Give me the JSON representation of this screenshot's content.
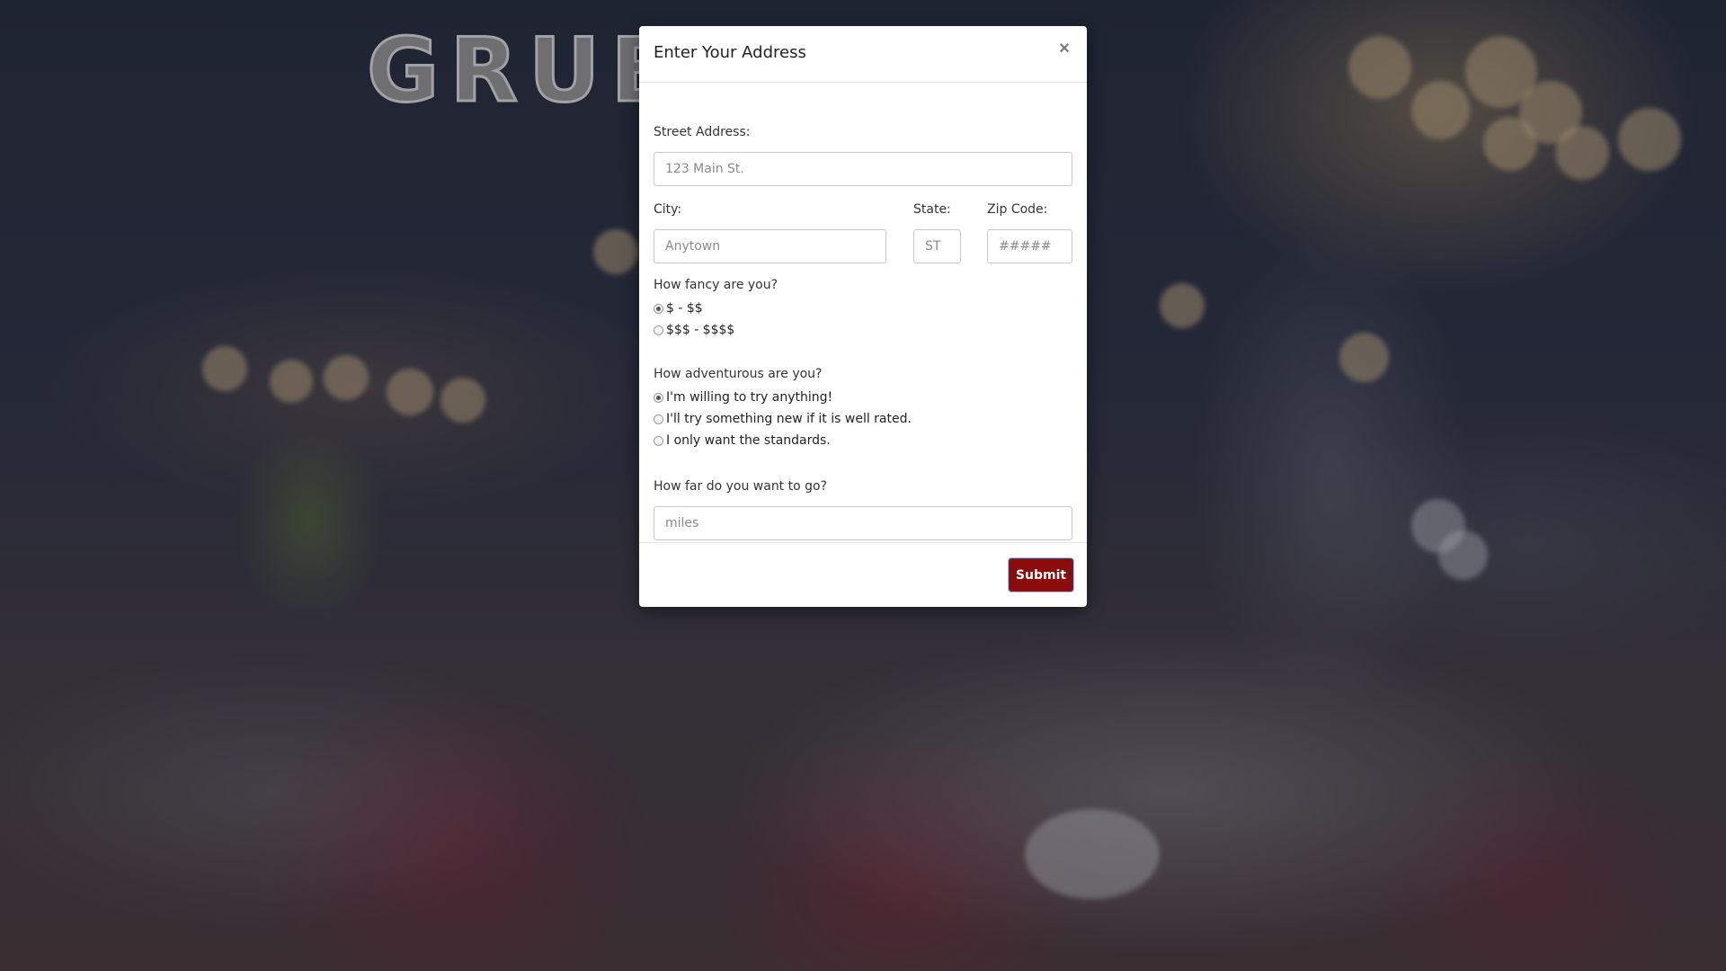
{
  "background": {
    "logo_text": "GRUB"
  },
  "modal": {
    "title": "Enter Your Address",
    "close_label": "×",
    "street": {
      "label": "Street Address:",
      "placeholder": "123 Main St."
    },
    "city": {
      "label": "City:",
      "placeholder": "Anytown"
    },
    "state": {
      "label": "State:",
      "placeholder": "ST"
    },
    "zip": {
      "label": "Zip Code:",
      "placeholder": "#####"
    },
    "fancy": {
      "question": "How fancy are you?",
      "options": [
        {
          "label": "$ - $$",
          "selected": true
        },
        {
          "label": "$$$ - $$$$",
          "selected": false
        }
      ]
    },
    "adventurous": {
      "question": "How adventurous are you?",
      "options": [
        {
          "label": "I'm willing to try anything!",
          "selected": true
        },
        {
          "label": "I'll try something new if it is well rated.",
          "selected": false
        },
        {
          "label": "I only want the standards.",
          "selected": false
        }
      ]
    },
    "distance": {
      "question": "How far do you want to go?",
      "placeholder": "miles"
    },
    "submit_label": "Submit"
  },
  "colors": {
    "submit_bg": "#8b0c0c",
    "submit_border": "#2c3e7a"
  }
}
